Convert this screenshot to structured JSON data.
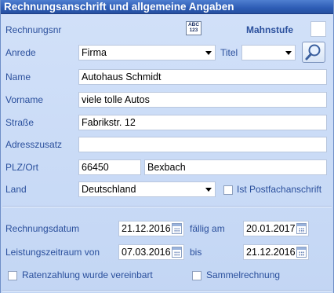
{
  "header": {
    "title": "Rechnungsanschrift und allgemeine Angaben"
  },
  "labels": {
    "rechnungsnr": "Rechnungsnr",
    "mahnstufe": "Mahnstufe",
    "anrede": "Anrede",
    "titel": "Titel",
    "name": "Name",
    "vorname": "Vorname",
    "strasse": "Straße",
    "adresszusatz": "Adresszusatz",
    "plzort": "PLZ/Ort",
    "land": "Land",
    "postfach": "Ist Postfachanschrift",
    "rechnungsdatum": "Rechnungsdatum",
    "faellig": "fällig am",
    "leistungszeitraum": "Leistungszeitraum von",
    "bis": "bis",
    "ratenzahlung": "Ratenzahlung wurde vereinbart",
    "sammelrechnung": "Sammelrechnung"
  },
  "fields": {
    "mahnstufe": "",
    "anrede": "Firma",
    "titel": "",
    "name": "Autohaus Schmidt",
    "vorname": "viele tolle Autos",
    "strasse": "Fabrikstr. 12",
    "adresszusatz": "",
    "plz": "66450",
    "ort": "Bexbach",
    "land": "Deutschland",
    "rechnungsdatum": "21.12.2016",
    "faellig": "20.01.2017",
    "leistung_von": "07.03.2016",
    "leistung_bis": "21.12.2016"
  },
  "checkboxes": {
    "postfach": false,
    "ratenzahlung": false,
    "sammelrechnung": false
  },
  "icons": {
    "abc_icon_text_top": "ABC",
    "abc_icon_text_bottom": "123"
  }
}
